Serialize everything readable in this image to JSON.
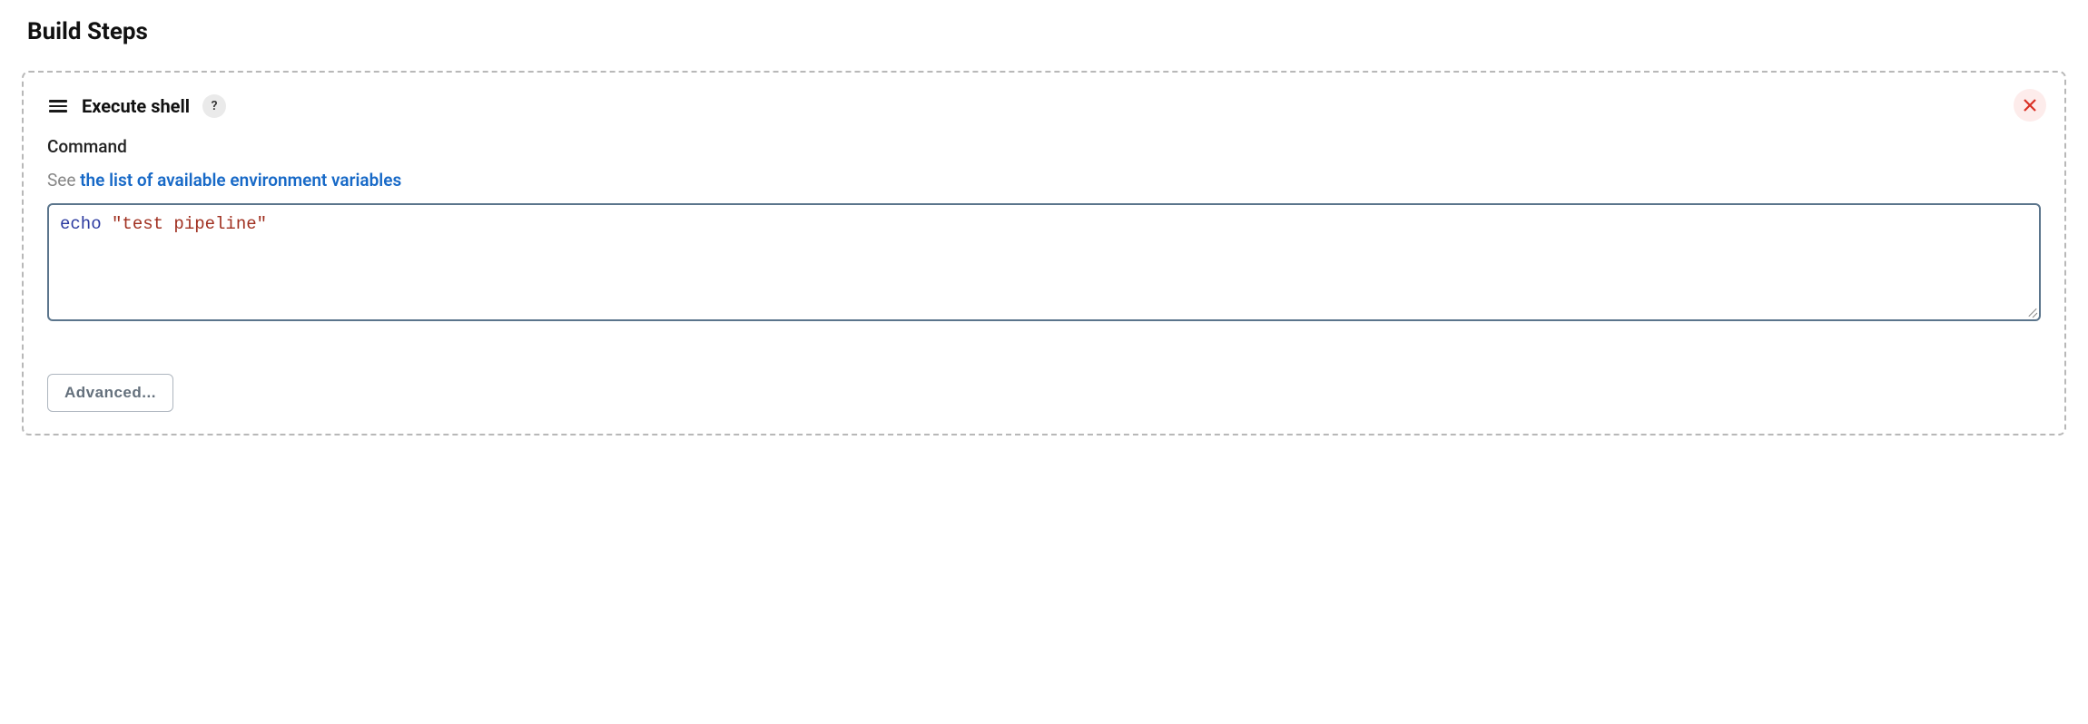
{
  "section": {
    "title": "Build Steps"
  },
  "step": {
    "title": "Execute shell",
    "help_symbol": "?",
    "command_label": "Command",
    "hint_prefix": "See ",
    "hint_link": "the list of available environment variables",
    "code": {
      "cmd": "echo",
      "str": "\"test pipeline\""
    },
    "advanced_label": "Advanced..."
  }
}
